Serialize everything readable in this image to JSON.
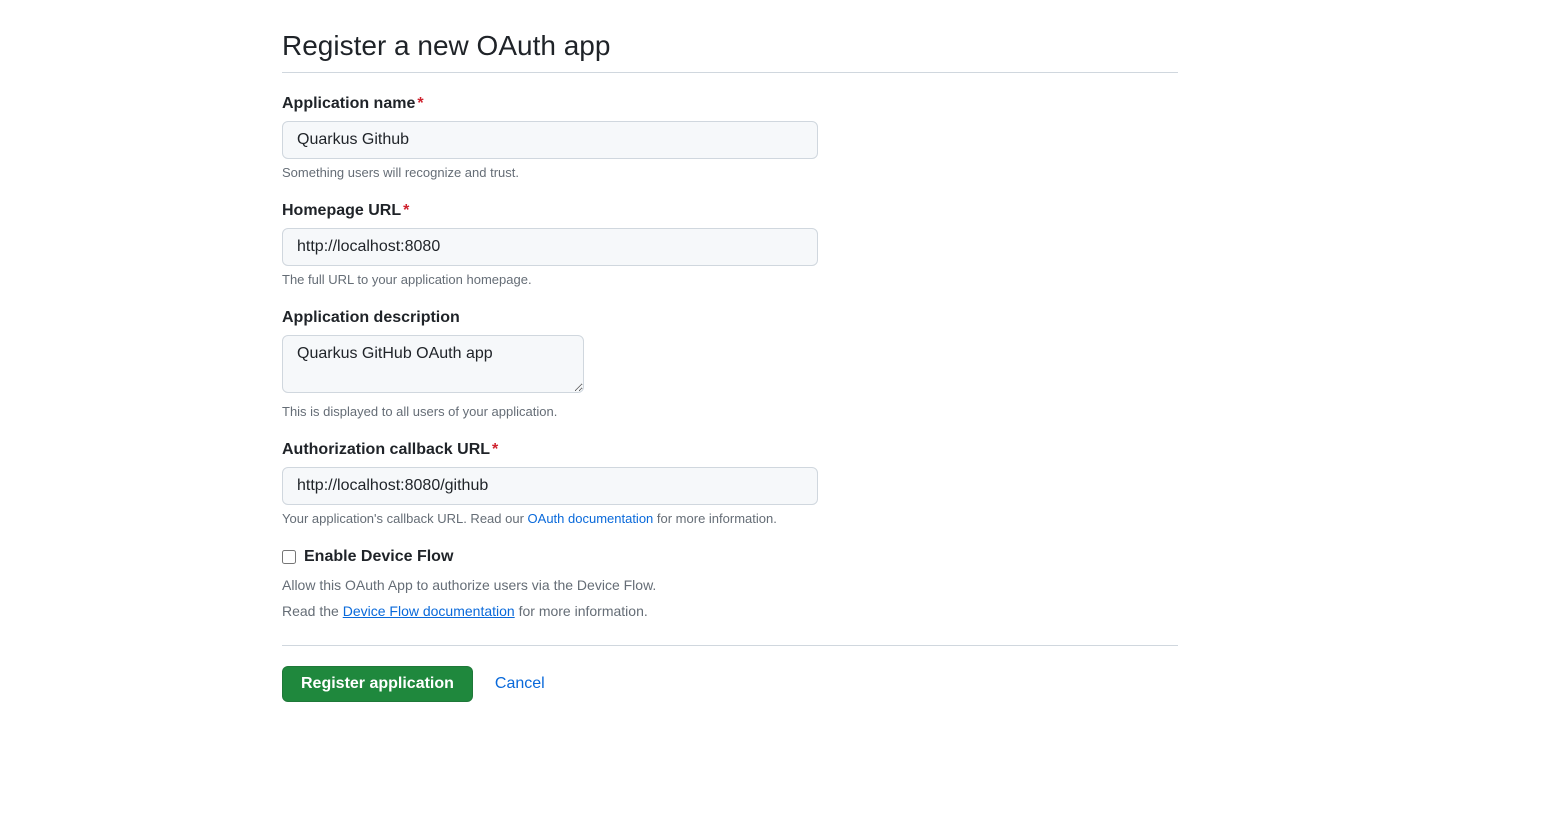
{
  "page": {
    "title": "Register a new OAuth app"
  },
  "form": {
    "appName": {
      "label": "Application name",
      "value": "Quarkus Github",
      "hint": "Something users will recognize and trust."
    },
    "homepageUrl": {
      "label": "Homepage URL",
      "value": "http://localhost:8080",
      "hint": "The full URL to your application homepage."
    },
    "description": {
      "label": "Application description",
      "value": "Quarkus GitHub OAuth app",
      "hint": "This is displayed to all users of your application."
    },
    "callbackUrl": {
      "label": "Authorization callback URL",
      "value": "http://localhost:8080/github",
      "hintPrefix": "Your application's callback URL. Read our ",
      "hintLink": "OAuth documentation",
      "hintSuffix": " for more information."
    },
    "deviceFlow": {
      "label": "Enable Device Flow",
      "hint1": "Allow this OAuth App to authorize users via the Device Flow.",
      "hint2Prefix": "Read the ",
      "hint2Link": "Device Flow documentation",
      "hint2Suffix": " for more information."
    }
  },
  "actions": {
    "submit": "Register application",
    "cancel": "Cancel"
  }
}
